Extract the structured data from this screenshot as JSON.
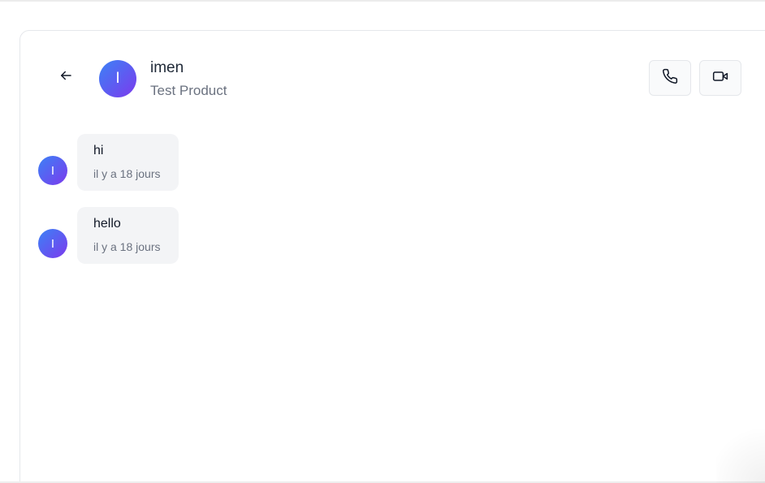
{
  "header": {
    "back_icon": "arrow-left-icon",
    "contact_initial": "I",
    "contact_name": "imen",
    "product_name": "Test Product",
    "call_icon": "phone-icon",
    "video_icon": "video-camera-icon"
  },
  "messages": [
    {
      "sender_initial": "I",
      "text": "hi",
      "time": "il y a 18 jours"
    },
    {
      "sender_initial": "I",
      "text": "hello",
      "time": "il y a 18 jours"
    }
  ],
  "colors": {
    "avatar_gradient_start": "#3b82f6",
    "avatar_gradient_end": "#7c3aed",
    "bubble_background": "#f3f4f6"
  }
}
